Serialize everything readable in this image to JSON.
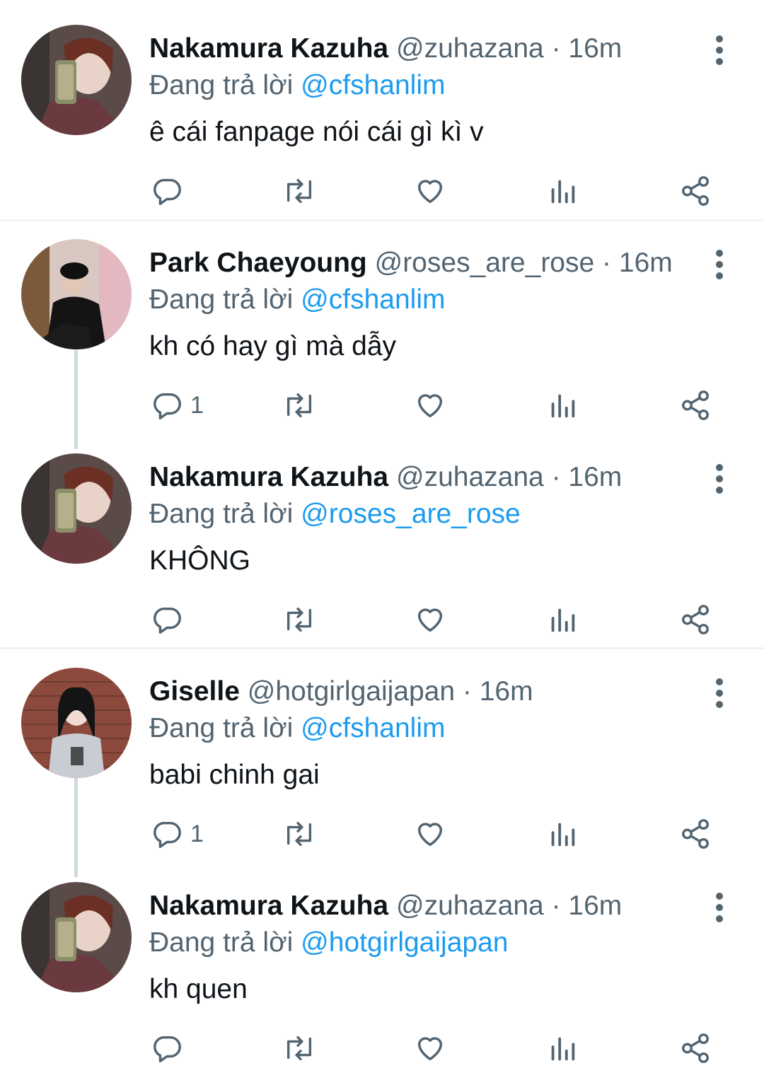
{
  "colors": {
    "name": "#0f1419",
    "secondary": "#536471",
    "link": "#1d9bf0",
    "thread_line": "#cfd9de",
    "divider": "#eff3f4"
  },
  "reply_prefix": "Đang trả lời",
  "tweets": [
    {
      "name": "Nakamura Kazuha",
      "handle": "@zuhazana",
      "dot": "·",
      "time": "16m",
      "reply_to": "@cfshanlim",
      "text": "ê cái fanpage nói cái gì kì v",
      "reply_count": "",
      "avatar": "kazuha-avatar"
    },
    {
      "name": "Park Chaeyoung",
      "handle": "@roses_are_rose",
      "dot": "·",
      "time": "16m",
      "reply_to": "@cfshanlim",
      "text": "kh có hay gì mà dẫy",
      "reply_count": "1",
      "avatar": "chaeyoung-avatar"
    },
    {
      "name": "Nakamura Kazuha",
      "handle": "@zuhazana",
      "dot": "·",
      "time": "16m",
      "reply_to": "@roses_are_rose",
      "text": "KHÔNG",
      "reply_count": "",
      "avatar": "kazuha-avatar"
    },
    {
      "name": "Giselle",
      "handle": "@hotgirlgaijapan",
      "dot": "·",
      "time": "16m",
      "reply_to": "@cfshanlim",
      "text": "babi chinh gai",
      "reply_count": "1",
      "avatar": "giselle-avatar"
    },
    {
      "name": "Nakamura Kazuha",
      "handle": "@zuhazana",
      "dot": "·",
      "time": "16m",
      "reply_to": "@hotgirlgaijapan",
      "text": "kh quen",
      "reply_count": "",
      "avatar": "kazuha-avatar"
    }
  ],
  "action_icons": [
    "reply-icon",
    "retweet-icon",
    "like-icon",
    "views-icon",
    "share-icon"
  ]
}
